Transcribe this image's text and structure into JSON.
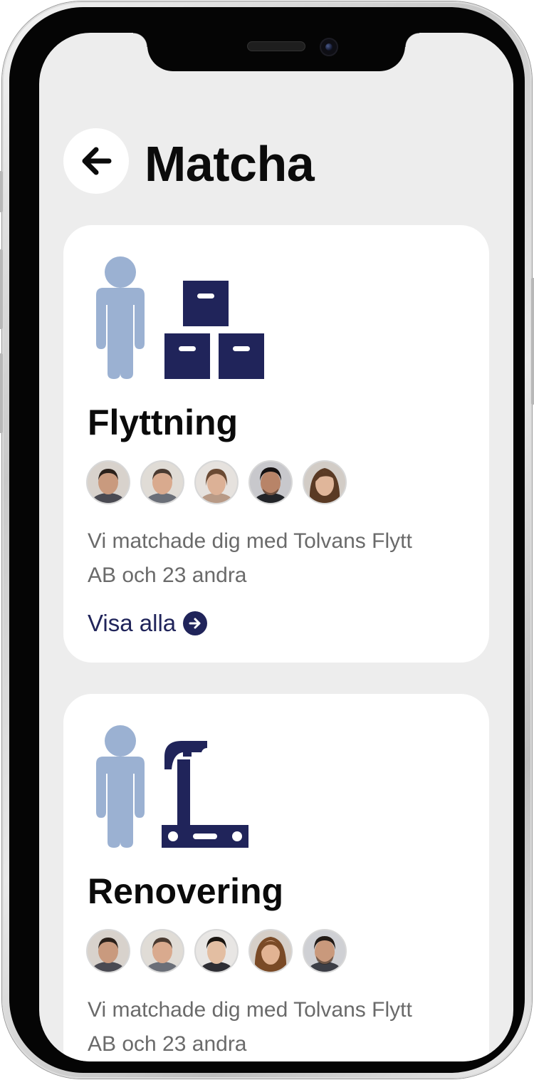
{
  "header": {
    "title": "Matcha",
    "back_icon": "arrow-left-icon"
  },
  "colors": {
    "primary": "#20245a",
    "person": "#9bb1d2",
    "background": "#ededed",
    "card": "#ffffff",
    "text_secondary": "#6a6a6a"
  },
  "cards": [
    {
      "title": "Flyttning",
      "illustration": "person-with-boxes-icon",
      "description": "Vi matchade dig med Tolvans Flytt AB och 23 andra",
      "link_label": "Visa alla",
      "link_icon": "arrow-right-circle-icon",
      "avatars": [
        {
          "name": "avatar-1",
          "skin": "#c99a7e",
          "hair": "#2b211b"
        },
        {
          "name": "avatar-2",
          "skin": "#d9aa8e",
          "hair": "#4a3a30"
        },
        {
          "name": "avatar-3",
          "skin": "#dcb196",
          "hair": "#6b4a33"
        },
        {
          "name": "avatar-4",
          "skin": "#b88468",
          "hair": "#161212"
        },
        {
          "name": "avatar-5",
          "skin": "#e0b69a",
          "hair": "#5a3a24"
        }
      ]
    },
    {
      "title": "Renovering",
      "illustration": "person-with-hammer-icon",
      "description": "Vi matchade dig med Tolvans Flytt AB och 23 andra",
      "avatars": [
        {
          "name": "avatar-1",
          "skin": "#c99a7e",
          "hair": "#2b211b"
        },
        {
          "name": "avatar-2",
          "skin": "#d9aa8e",
          "hair": "#4a3a30"
        },
        {
          "name": "avatar-3",
          "skin": "#e3bea2",
          "hair": "#1a1510"
        },
        {
          "name": "avatar-4",
          "skin": "#e2b393",
          "hair": "#7a4a26"
        },
        {
          "name": "avatar-5",
          "skin": "#c9997c",
          "hair": "#221a16"
        }
      ]
    }
  ]
}
